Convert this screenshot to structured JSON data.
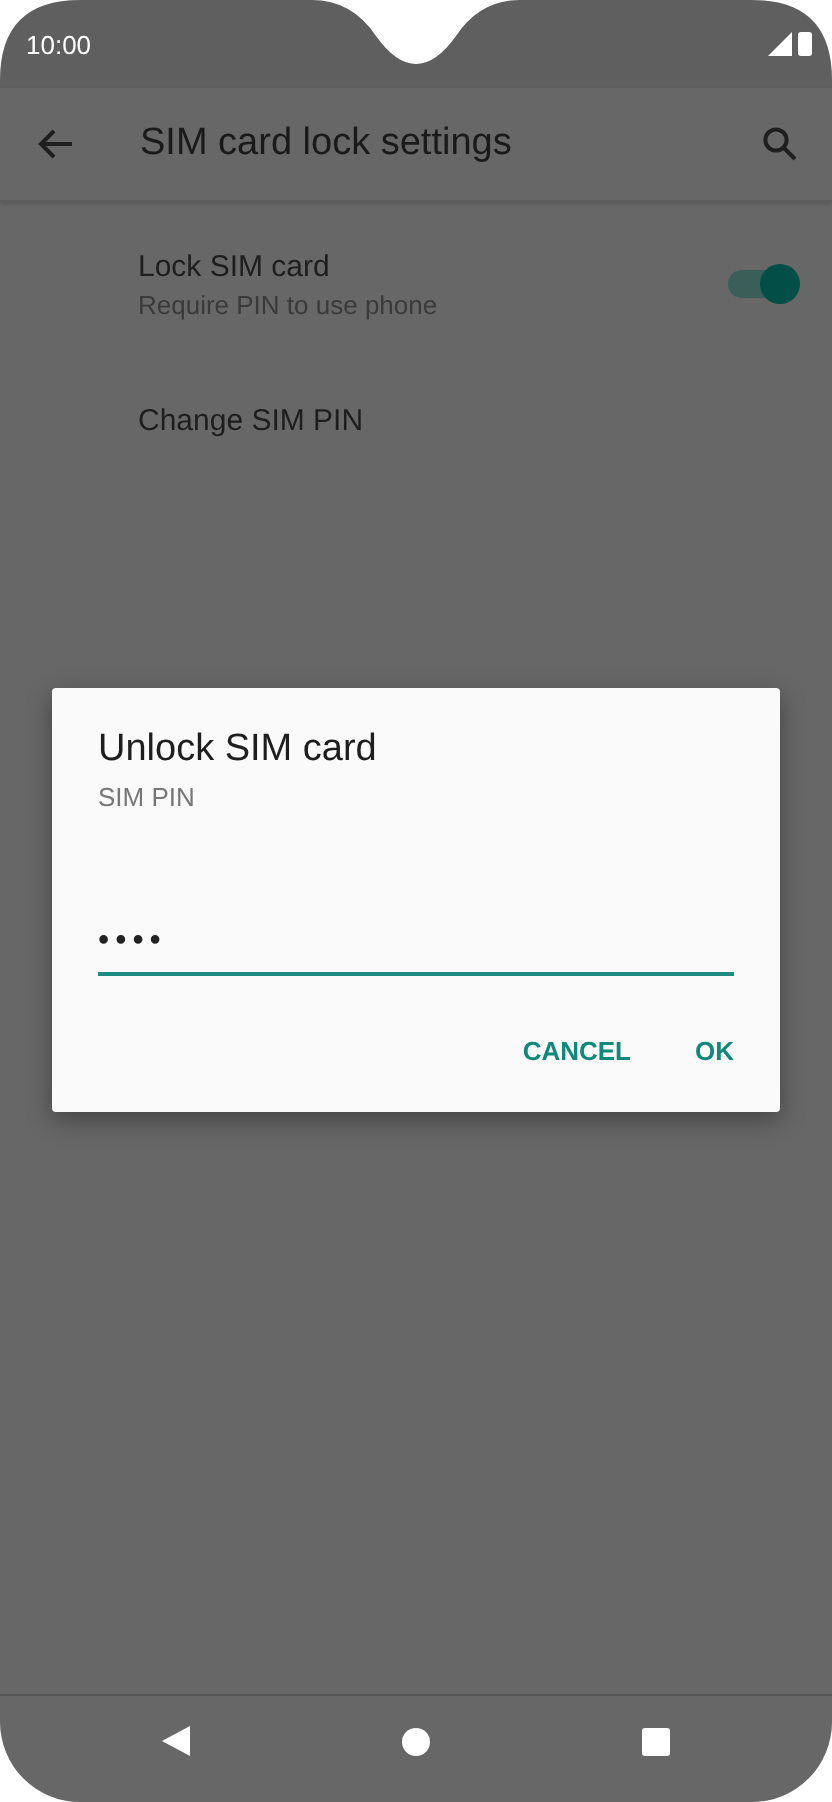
{
  "status_bar": {
    "time": "10:00"
  },
  "app_bar": {
    "title": "SIM card lock settings"
  },
  "settings": [
    {
      "kind": "toggle",
      "title": "Lock SIM card",
      "summary": "Require PIN to use phone",
      "on": true
    },
    {
      "kind": "plain",
      "title": "Change SIM PIN"
    }
  ],
  "dialog": {
    "title": "Unlock SIM card",
    "message": "SIM PIN",
    "field": {
      "value": "••••"
    },
    "buttons": [
      "CANCEL",
      "OK"
    ]
  }
}
